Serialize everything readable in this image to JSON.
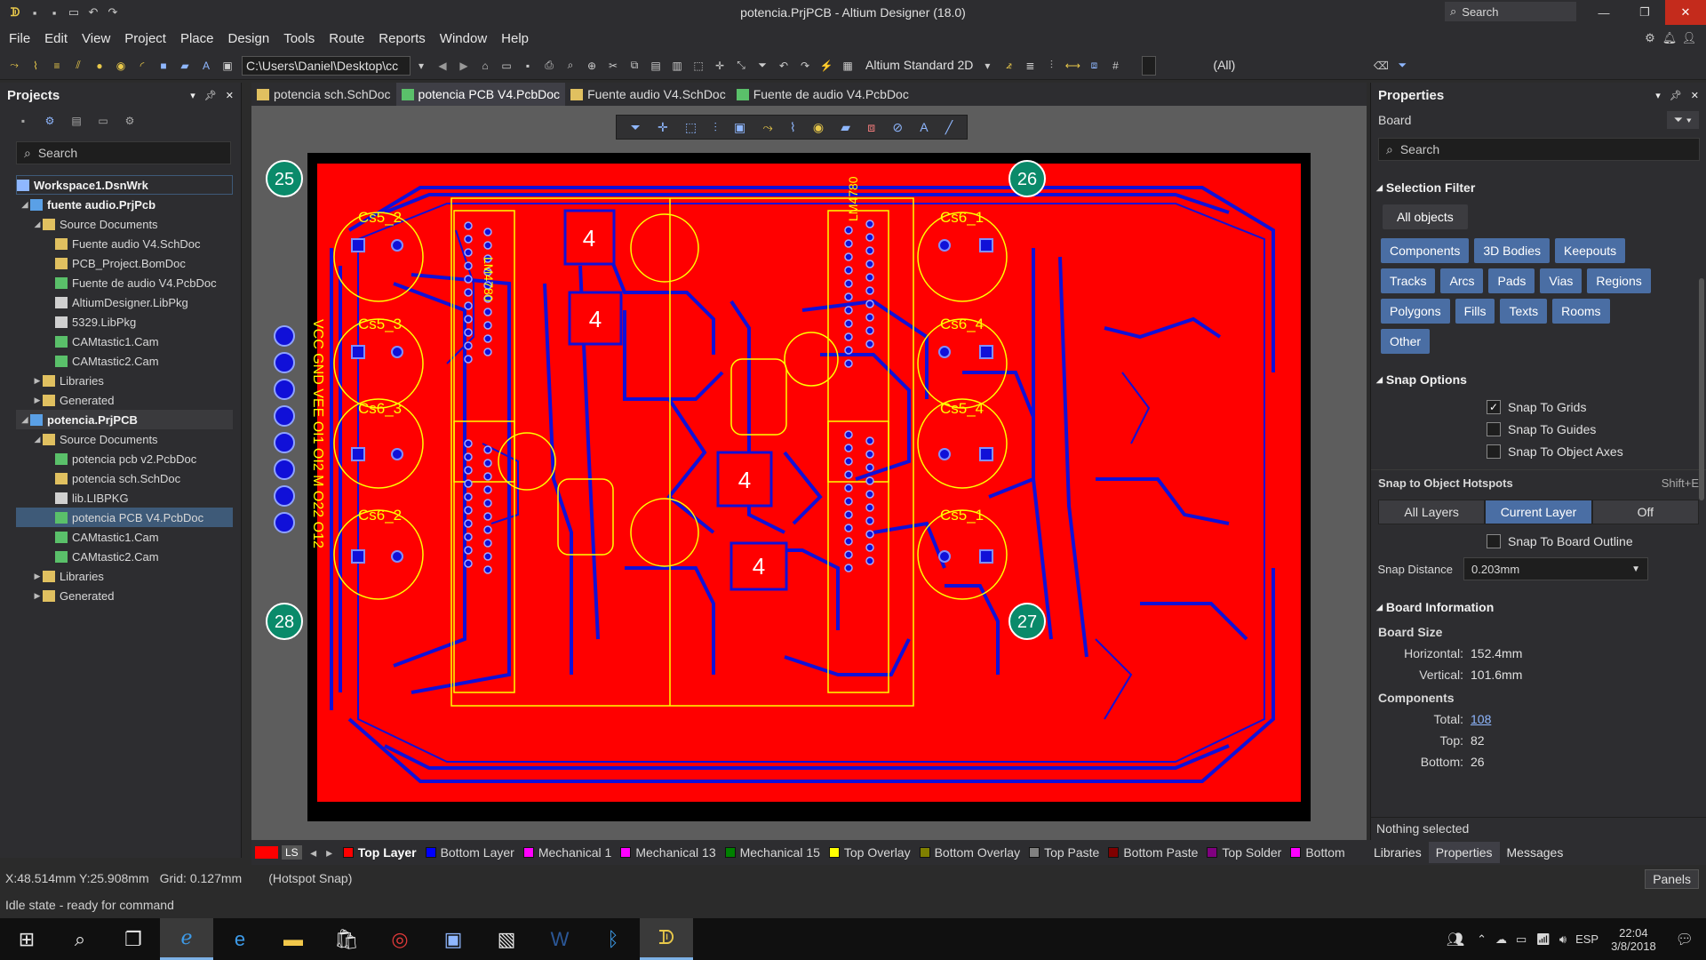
{
  "window": {
    "title": "potencia.PrjPCB - Altium Designer (18.0)",
    "search_placeholder": "Search"
  },
  "menu": [
    "File",
    "Edit",
    "View",
    "Project",
    "Place",
    "Design",
    "Tools",
    "Route",
    "Reports",
    "Window",
    "Help"
  ],
  "toolbar": {
    "path": "C:\\Users\\Daniel\\Desktop\\cc",
    "view_mode": "Altium Standard 2D",
    "filter_all": "(All)"
  },
  "projects_panel": {
    "title": "Projects",
    "search_placeholder": "Search",
    "workspace": "Workspace1.DsnWrk",
    "tree": [
      {
        "label": "fuente audio.PrjPcb",
        "level": 1,
        "kind": "project",
        "expanded": true
      },
      {
        "label": "Source Documents",
        "level": 2,
        "kind": "folder",
        "expanded": true
      },
      {
        "label": "Fuente audio V4.SchDoc",
        "level": 3,
        "kind": "sch"
      },
      {
        "label": "PCB_Project.BomDoc",
        "level": 3,
        "kind": "bom"
      },
      {
        "label": "Fuente de audio V4.PcbDoc",
        "level": 3,
        "kind": "pcb"
      },
      {
        "label": "AltiumDesigner.LibPkg",
        "level": 3,
        "kind": "lib"
      },
      {
        "label": "5329.LibPkg",
        "level": 3,
        "kind": "lib"
      },
      {
        "label": "CAMtastic1.Cam",
        "level": 3,
        "kind": "cam"
      },
      {
        "label": "CAMtastic2.Cam",
        "level": 3,
        "kind": "cam"
      },
      {
        "label": "Libraries",
        "level": 2,
        "kind": "folder",
        "expanded": false
      },
      {
        "label": "Generated",
        "level": 2,
        "kind": "folder",
        "expanded": false
      },
      {
        "label": "potencia.PrjPCB",
        "level": 1,
        "kind": "project",
        "expanded": true,
        "current": true
      },
      {
        "label": "Source Documents",
        "level": 2,
        "kind": "folder",
        "expanded": true
      },
      {
        "label": "potencia pcb v2.PcbDoc",
        "level": 3,
        "kind": "pcb"
      },
      {
        "label": "potencia sch.SchDoc",
        "level": 3,
        "kind": "sch"
      },
      {
        "label": "lib.LIBPKG",
        "level": 3,
        "kind": "lib"
      },
      {
        "label": "potencia PCB V4.PcbDoc",
        "level": 3,
        "kind": "pcb",
        "selected": true
      },
      {
        "label": "CAMtastic1.Cam",
        "level": 3,
        "kind": "cam"
      },
      {
        "label": "CAMtastic2.Cam",
        "level": 3,
        "kind": "cam"
      },
      {
        "label": "Libraries",
        "level": 2,
        "kind": "folder",
        "expanded": false
      },
      {
        "label": "Generated",
        "level": 2,
        "kind": "folder",
        "expanded": false
      }
    ]
  },
  "doc_tabs": [
    {
      "label": "potencia sch.SchDoc",
      "active": false,
      "kind": "sch"
    },
    {
      "label": "potencia PCB V4.PcbDoc",
      "active": true,
      "kind": "pcb"
    },
    {
      "label": "Fuente audio V4.SchDoc",
      "active": false,
      "kind": "sch"
    },
    {
      "label": "Fuente de audio V4.PcbDoc",
      "active": false,
      "kind": "pcb"
    }
  ],
  "pcb": {
    "corner_labels": [
      "25",
      "26",
      "28",
      "27"
    ],
    "silk_labels": [
      "Cs5_2",
      "Cs5_3",
      "Cs6_3",
      "Cs6_2",
      "Cs6_1",
      "Cs6_4",
      "Cs5_4",
      "Cs5_1",
      "LM4780",
      "LM4780",
      "VCC GND VEE OI1 OI2 M O22 O12"
    ],
    "pad_4_labels": [
      "4",
      "4",
      "4",
      "4"
    ]
  },
  "layer_bar": {
    "ls_label": "LS",
    "layers": [
      {
        "name": "Top Layer",
        "color": "#ff0000",
        "active": true
      },
      {
        "name": "Bottom Layer",
        "color": "#0000ff"
      },
      {
        "name": "Mechanical 1",
        "color": "#ff00ff"
      },
      {
        "name": "Mechanical 13",
        "color": "#ff00ff"
      },
      {
        "name": "Mechanical 15",
        "color": "#008000"
      },
      {
        "name": "Top Overlay",
        "color": "#ffff00"
      },
      {
        "name": "Bottom Overlay",
        "color": "#808000"
      },
      {
        "name": "Top Paste",
        "color": "#808080"
      },
      {
        "name": "Bottom Paste",
        "color": "#800000"
      },
      {
        "name": "Top Solder",
        "color": "#800080"
      },
      {
        "name": "Bottom",
        "color": "#ff00ff"
      }
    ]
  },
  "properties_panel": {
    "title": "Properties",
    "object": "Board",
    "search_placeholder": "Search",
    "selection_filter": {
      "title": "Selection Filter",
      "all": "All objects",
      "chips": [
        "Components",
        "3D Bodies",
        "Keepouts",
        "Tracks",
        "Arcs",
        "Pads",
        "Vias",
        "Regions",
        "Polygons",
        "Fills",
        "Texts",
        "Rooms",
        "Other"
      ]
    },
    "snap_options": {
      "title": "Snap Options",
      "checks": [
        {
          "label": "Snap To Grids",
          "checked": true
        },
        {
          "label": "Snap To Guides",
          "checked": false
        },
        {
          "label": "Snap To Object Axes",
          "checked": false
        }
      ],
      "hotspots_title": "Snap to Object Hotspots",
      "hotspots_shortcut": "Shift+E",
      "hotspots_modes": [
        "All Layers",
        "Current Layer",
        "Off"
      ],
      "hotspots_selected": "Current Layer",
      "board_outline": "Snap To Board Outline",
      "snap_distance_label": "Snap Distance",
      "snap_distance": "0.203mm"
    },
    "board_info": {
      "title": "Board Information",
      "size_title": "Board Size",
      "horizontal_label": "Horizontal:",
      "horizontal": "152.4mm",
      "vertical_label": "Vertical:",
      "vertical": "101.6mm",
      "components_title": "Components",
      "total_label": "Total:",
      "total": "108",
      "top_label": "Top:",
      "top": "82",
      "bottom_label": "Bottom:",
      "bottom": "26"
    },
    "footer": "Nothing selected"
  },
  "right_tabs": [
    "Libraries",
    "Properties",
    "Messages"
  ],
  "status": {
    "coords": "X:48.514mm Y:25.908mm",
    "grid": "Grid: 0.127mm",
    "snap": "(Hotspot Snap)",
    "state": "Idle state - ready for command",
    "panels_btn": "Panels"
  },
  "taskbar": {
    "lang": "ESP",
    "time": "22:04",
    "date": "3/8/2018"
  }
}
